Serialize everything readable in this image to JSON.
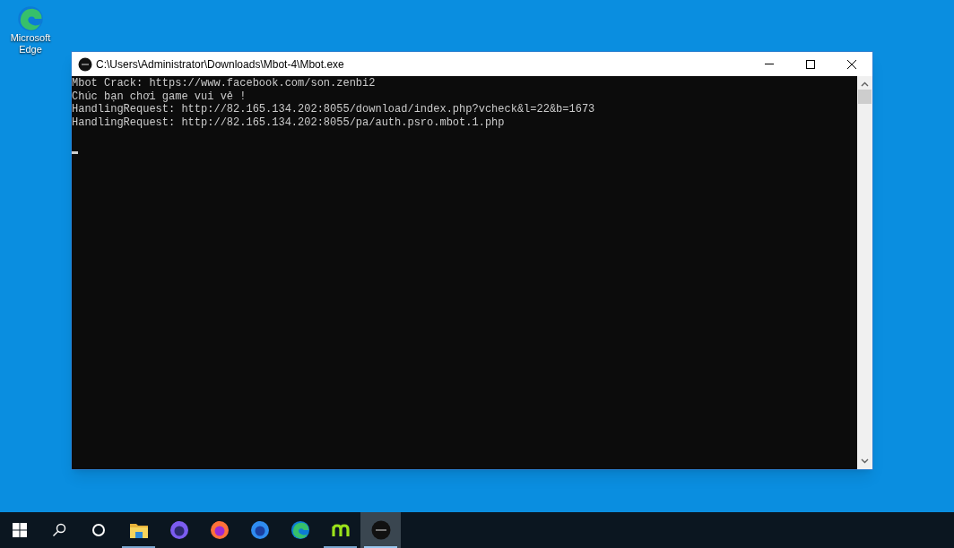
{
  "desktop_icons": [
    {
      "label": "Microsoft Edge"
    }
  ],
  "window": {
    "title": "C:\\Users\\Administrator\\Downloads\\Mbot-4\\Mbot.exe"
  },
  "console": {
    "lines": [
      "Mbot Crack: https://www.facebook.com/son.zenbi2",
      "Chúc bạn chơi game vui vẻ !",
      "HandlingRequest: http://82.165.134.202:8055/download/index.php?vcheck&l=22&b=1673",
      "HandlingRequest: http://82.165.134.202:8055/pa/auth.psro.mbot.1.php"
    ],
    "cursor": true
  },
  "taskbar": {
    "items": [
      {
        "kind": "start",
        "running": false,
        "selected": false
      },
      {
        "kind": "search",
        "running": false,
        "selected": false
      },
      {
        "kind": "cortana",
        "running": false,
        "selected": false
      },
      {
        "kind": "explorer",
        "running": true,
        "selected": false
      },
      {
        "kind": "firefox-nightly",
        "running": false,
        "selected": false
      },
      {
        "kind": "firefox",
        "running": false,
        "selected": false
      },
      {
        "kind": "firefox-dev",
        "running": false,
        "selected": false
      },
      {
        "kind": "edge",
        "running": false,
        "selected": false
      },
      {
        "kind": "m-app",
        "running": true,
        "selected": false
      },
      {
        "kind": "mbot",
        "running": true,
        "selected": true
      }
    ]
  }
}
